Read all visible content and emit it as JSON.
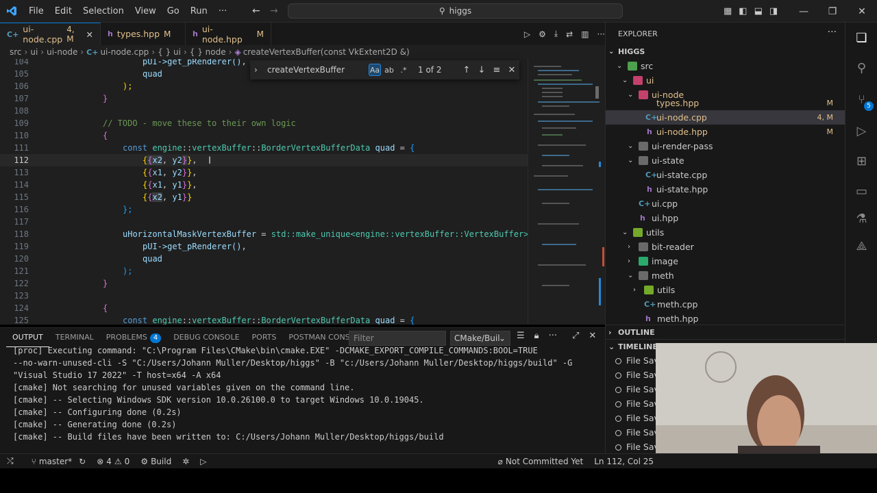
{
  "title_bar": {
    "menu": [
      "File",
      "Edit",
      "Selection",
      "View",
      "Go",
      "Run",
      "···"
    ],
    "search": "higgs"
  },
  "tabs": [
    {
      "label": "ui-node.cpp",
      "status": "4, M",
      "active": true
    },
    {
      "label": "types.hpp",
      "status": "M",
      "active": false
    },
    {
      "label": "ui-node.hpp",
      "status": "M",
      "active": false
    }
  ],
  "breadcrumb": [
    "src",
    "ui",
    "ui-node",
    "ui-node.cpp",
    "{ } ui",
    "{ } node",
    "createVertexBuffer(const VkExtent2D &)"
  ],
  "find_widget": {
    "query": "createVertexBuffer",
    "match_case": "Aa",
    "whole_word": "ab",
    "regex": ".*",
    "count": "1 of 2"
  },
  "editor": {
    "line_numbers": [
      "104",
      "105",
      "106",
      "107",
      "108",
      "109",
      "110",
      "111",
      "112",
      "113",
      "114",
      "115",
      "116",
      "117",
      "118",
      "119",
      "120",
      "121",
      "122",
      "123",
      "124",
      "125"
    ],
    "current_line": "112",
    "code": {
      "l104": "pUI->get_pRenderer(),",
      "l105": "quad",
      "l106": ");",
      "l107": "}",
      "l109": "// TODO - move these to their own logic",
      "l110": "{",
      "l111_kw": "const",
      "l111_ns": "engine",
      "l111_ns2": "vertexBuffer",
      "l111_type": "BorderVertexBufferData",
      "l111_var": "quad",
      "l112": [
        "x2",
        "y2"
      ],
      "l113": [
        "x1",
        "y2"
      ],
      "l114": [
        "x1",
        "y1"
      ],
      "l115": [
        "x2",
        "y1"
      ],
      "l116": "};",
      "l118_var": "uHorizontalMaskVertexBuffer",
      "l118_rest": "std::make_unique<engine::vertexBuffer::VertexBuffer>",
      "l119": "pUI->get_pRenderer(),",
      "l120": "quad",
      "l121": ");",
      "l122": "}",
      "l124": "{",
      "l125_kw": "const",
      "l125_ns": "engine",
      "l125_ns2": "vertexBuffer",
      "l125_type": "BorderVertexBufferData",
      "l125_var": "quad"
    }
  },
  "panel": {
    "tabs": [
      "OUTPUT",
      "TERMINAL",
      "PROBLEMS",
      "DEBUG CONSOLE",
      "PORTS",
      "POSTMAN CONSOLE"
    ],
    "problems_count": "4",
    "filter_placeholder": "Filter",
    "channel": "CMake/Buil",
    "output_lines": [
      "[proc] Executing command: \"C:\\Program Files\\CMake\\bin\\cmake.EXE\" -DCMAKE_EXPORT_COMPILE_COMMANDS:BOOL=TRUE",
      "--no-warn-unused-cli -S \"C:/Users/Johann Muller/Desktop/higgs\" -B \"c:/Users/Johann Muller/Desktop/higgs/build\" -G",
      "\"Visual Studio 17 2022\" -T host=x64 -A x64",
      "[cmake] Not searching for unused variables given on the command line.",
      "[cmake] -- Selecting Windows SDK version 10.0.26100.0 to target Windows 10.0.19045.",
      "[cmake] -- Configuring done (0.2s)",
      "[cmake] -- Generating done (0.2s)",
      "[cmake] -- Build files have been written to: C:/Users/Johann Muller/Desktop/higgs/build"
    ]
  },
  "explorer": {
    "title": "EXPLORER",
    "root": "HIGGS",
    "items": [
      {
        "label": "src",
        "kind": "folder"
      },
      {
        "label": "ui",
        "kind": "folder"
      },
      {
        "label": "ui-node",
        "kind": "folder"
      },
      {
        "label": "types.hpp",
        "kind": "file",
        "status": "M"
      },
      {
        "label": "ui-node.cpp",
        "kind": "file",
        "status": "4, M"
      },
      {
        "label": "ui-node.hpp",
        "kind": "file",
        "status": "M"
      },
      {
        "label": "ui-render-pass",
        "kind": "folder"
      },
      {
        "label": "ui-state",
        "kind": "folder"
      },
      {
        "label": "ui-state.cpp",
        "kind": "file"
      },
      {
        "label": "ui-state.hpp",
        "kind": "file"
      },
      {
        "label": "ui.cpp",
        "kind": "file"
      },
      {
        "label": "ui.hpp",
        "kind": "file"
      },
      {
        "label": "utils",
        "kind": "folder"
      },
      {
        "label": "bit-reader",
        "kind": "folder"
      },
      {
        "label": "image",
        "kind": "folder"
      },
      {
        "label": "meth",
        "kind": "folder"
      },
      {
        "label": "utils",
        "kind": "folder"
      },
      {
        "label": "meth.cpp",
        "kind": "file"
      },
      {
        "label": "meth.hpp",
        "kind": "file"
      }
    ],
    "outline": "OUTLINE",
    "timeline": "TIMELINE",
    "timeline_items": [
      "File Save",
      "File Save",
      "File Save",
      "File Save",
      "File Save",
      "File Save",
      "File Save"
    ]
  },
  "status_bar": {
    "branch": "master*",
    "errors": "4",
    "warnings": "0",
    "build": "Build",
    "blame": "Not Committed Yet",
    "position": "Ln 112, Col 25"
  },
  "colors": {
    "accent": "#0078d4",
    "modified": "#e2c08d",
    "keyword": "#569cd6",
    "type": "#4ec9b0",
    "function": "#dcdcaa",
    "variable": "#9cdcfe",
    "comment": "#6a9955"
  }
}
